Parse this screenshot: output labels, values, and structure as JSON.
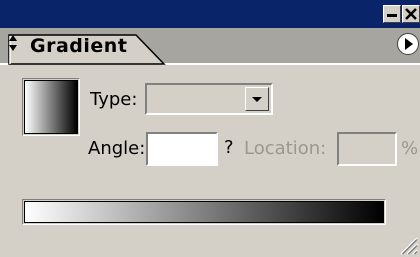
{
  "panel": {
    "tab_label": "Gradient"
  },
  "fields": {
    "type_label": "Type:",
    "type_value": "",
    "angle_label": "Angle:",
    "angle_value": "",
    "question_mark": "?",
    "location_label": "Location:",
    "location_value": "",
    "percent_label": "%"
  },
  "gradient": {
    "start_color": "#ffffff",
    "end_color": "#000000"
  },
  "colors": {
    "title_bar": "#0a246a",
    "panel_bg": "#d4d0c8",
    "disabled_text": "#9a978f"
  },
  "icons": {
    "minimize": "minimize-icon",
    "close": "close-icon",
    "tab_toggle": "up-down-arrows-icon",
    "panel_menu": "panel-menu-icon",
    "dropdown": "chevron-down-icon",
    "resize": "resize-grip-icon"
  }
}
